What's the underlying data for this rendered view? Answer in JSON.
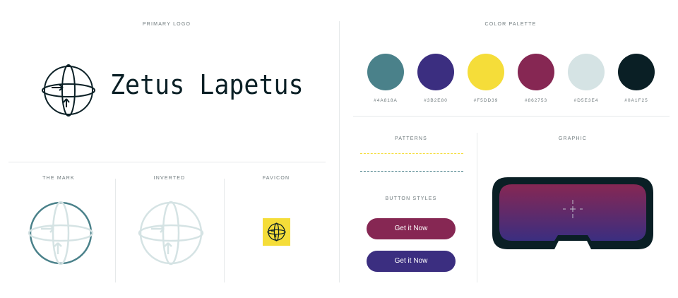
{
  "sections": {
    "primary_logo": "PRIMARY LOGO",
    "color_palette": "COLOR PALETTE",
    "the_mark": "THE MARK",
    "inverted": "INVERTED",
    "favicon": "FAVICON",
    "patterns": "PATTERNS",
    "button_styles": "BUTTON STYLES",
    "graphic": "GRAPHIC"
  },
  "brand": {
    "name": "Zetus Lapetus"
  },
  "palette": [
    {
      "hex": "#4A818A",
      "label": "#4A818A"
    },
    {
      "hex": "#3B2E80",
      "label": "#3B2E80"
    },
    {
      "hex": "#F5DD39",
      "label": "#F5DD39"
    },
    {
      "hex": "#862753",
      "label": "#862753"
    },
    {
      "hex": "#D5E3E4",
      "label": "#D5E3E4"
    },
    {
      "hex": "#0A1F25",
      "label": "#0A1F25"
    }
  ],
  "buttons": {
    "primary_label": "Get it Now",
    "secondary_label": "Get it Now",
    "primary_color": "#862753",
    "secondary_color": "#3B2E80"
  },
  "patterns": {
    "line1_color": "#F5DD39",
    "line2_color": "#4A818A"
  },
  "icons": {
    "primary_mark": "globe-arrows-icon",
    "favicon": "globe-arrows-icon"
  }
}
